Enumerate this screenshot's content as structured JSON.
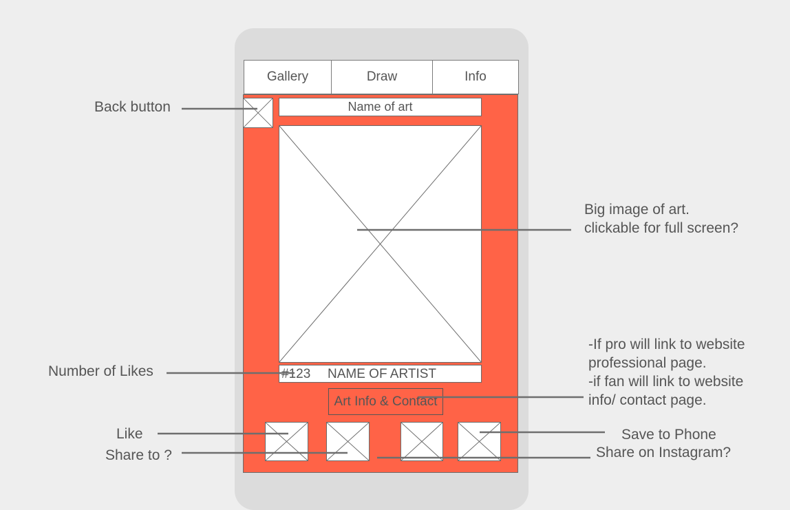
{
  "tabs": [
    {
      "label": "Gallery"
    },
    {
      "label": "Draw"
    },
    {
      "label": "Info"
    }
  ],
  "art": {
    "title": "Name of art",
    "likes": "#123",
    "artist": "NAME OF ARTIST",
    "info_button": "Art Info & Contact"
  },
  "annotations": {
    "back_button": "Back button",
    "big_image_line1": "Big image of art.",
    "big_image_line2": "clickable for full screen?",
    "number_of_likes": "Number of Likes",
    "link_line1": "-If pro will link to website",
    "link_line2": "professional page.",
    "link_line3": "-if fan will link to website",
    "link_line4": "info/ contact page.",
    "like": "Like",
    "share_to": "Share to ?",
    "save_to_phone": "Save to Phone",
    "share_instagram": "Share on Instagram?"
  },
  "colors": {
    "screen": "#ff6347",
    "phone": "#dcdcdc",
    "background": "#eeeeee"
  },
  "icons": [
    "back-icon",
    "like-icon",
    "share-icon",
    "instagram-share-icon",
    "save-to-phone-icon"
  ]
}
